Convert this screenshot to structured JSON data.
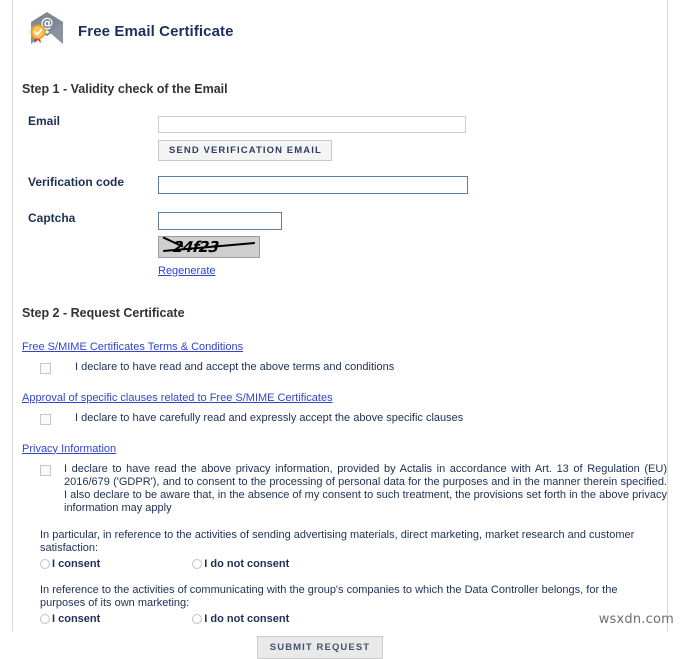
{
  "header": {
    "title": "Free Email Certificate",
    "icon": "email-certificate-icon"
  },
  "step1": {
    "heading": "Step 1 - Validity check of the Email",
    "email": {
      "label": "Email",
      "value": "",
      "placeholder": ""
    },
    "send_verification_button": "SEND VERIFICATION EMAIL",
    "verification_code": {
      "label": "Verification code",
      "value": "",
      "placeholder": ""
    },
    "captcha": {
      "label": "Captcha",
      "value": "",
      "placeholder": "",
      "image_text": "24f23",
      "regenerate_link": "Regenerate"
    }
  },
  "step2": {
    "heading": "Step 2 - Request Certificate",
    "terms_link": "Free S/MIME Certificates Terms & Conditions",
    "terms_declaration": "I declare to have read and accept the above terms and conditions",
    "clauses_link": "Approval of specific clauses related to Free S/MIME Certificates",
    "clauses_declaration": "I declare to have carefully read and expressly accept the above specific clauses",
    "privacy_link": "Privacy Information",
    "privacy_declaration": "I declare to have read the above privacy information, provided by Actalis in accordance with Art. 13 of Regulation (EU) 2016/679 ('GDPR'), and to consent to the processing of personal data for the purposes and in the manner therein specified. I also declare to be aware that, in the absence of my consent to such treatment, the provisions set forth in the above privacy information may apply",
    "consent_blocks": [
      {
        "intro": "In particular, in reference to the activities of sending advertising materials, direct marketing, market research and customer satisfaction:",
        "yes_label": "I consent",
        "no_label": "I do not consent"
      },
      {
        "intro": "In reference to the activities of communicating with the group's companies to which the Data Controller belongs, for the purposes of its own marketing:",
        "yes_label": "I consent",
        "no_label": "I do not consent"
      }
    ],
    "submit_button": "SUBMIT REQUEST"
  },
  "watermark": "wsxdn.com",
  "colors": {
    "title": "#1c2f5c",
    "heading": "#333333",
    "label": "#1c3055",
    "link": "#3344cc",
    "input_border_blue": "#5c7da6",
    "input_border_pale": "#cfcfcf",
    "button_bg": "#f4f4f4"
  }
}
